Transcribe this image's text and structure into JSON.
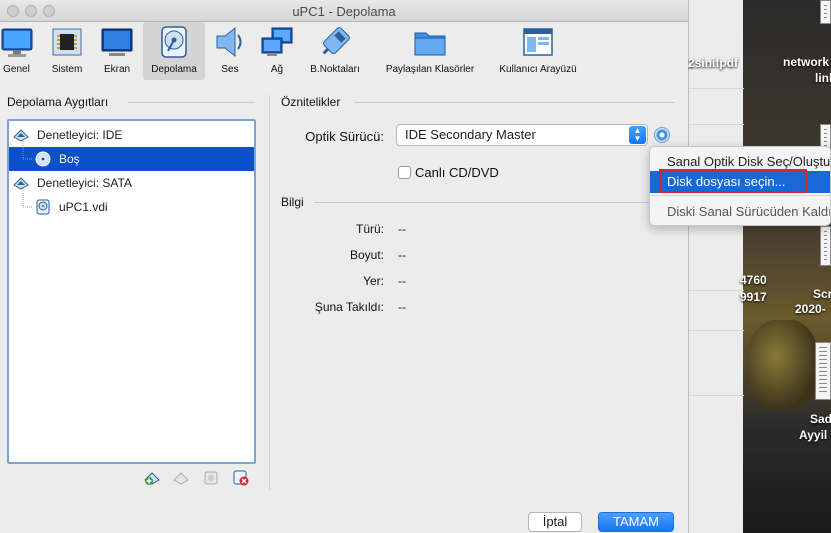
{
  "window": {
    "title": "uPC1 - Depolama"
  },
  "toolbar": {
    "items": [
      {
        "label": "Genel",
        "icon": "monitor-icon"
      },
      {
        "label": "Sistem",
        "icon": "chip-icon"
      },
      {
        "label": "Ekran",
        "icon": "display-icon"
      },
      {
        "label": "Depolama",
        "icon": "disk-icon",
        "active": true
      },
      {
        "label": "Ses",
        "icon": "speaker-icon"
      },
      {
        "label": "Ağ",
        "icon": "network-icon"
      },
      {
        "label": "B.Noktaları",
        "icon": "serial-port-icon"
      },
      {
        "label": "Paylaşılan Klasörler",
        "icon": "folder-icon"
      },
      {
        "label": "Kullanıcı Arayüzü",
        "icon": "window-icon"
      }
    ]
  },
  "storage": {
    "heading": "Depolama Aygıtları",
    "tree": [
      {
        "label": "Denetleyici: IDE",
        "type": "controller"
      },
      {
        "label": "Boş",
        "type": "optical",
        "selected": true
      },
      {
        "label": "Denetleyici: SATA",
        "type": "controller"
      },
      {
        "label": "uPC1.vdi",
        "type": "hdd"
      }
    ]
  },
  "attributes": {
    "heading": "Öznitelikler",
    "optical_drive_label": "Optik Sürücü:",
    "optical_drive_value": "IDE Secondary Master",
    "live_cd_label": "Canlı CD/DVD"
  },
  "info": {
    "heading": "Bilgi",
    "rows": [
      {
        "label": "Türü:",
        "value": "--"
      },
      {
        "label": "Boyut:",
        "value": "--"
      },
      {
        "label": "Yer:",
        "value": "--"
      },
      {
        "label": "Şuna Takıldı:",
        "value": "--"
      }
    ]
  },
  "menu": {
    "items": [
      {
        "label": "Sanal Optik Disk Seç/Oluştur..."
      },
      {
        "label": "Disk dosyası seçin...",
        "highlighted": true
      },
      {
        "label": "Diski Sanal Sürücüden Kaldır"
      }
    ]
  },
  "buttons": {
    "cancel": "İptal",
    "ok": "TAMAM"
  },
  "desktop": {
    "labels": [
      "2sinifpdf",
      "network",
      "link",
      "4760",
      "9917",
      "Scr",
      "2020-",
      "Sad",
      "Ayyil"
    ]
  },
  "colors": {
    "accent": "#1868d8",
    "selection": "#0a50c8",
    "highlight_box": "#d6262a"
  }
}
